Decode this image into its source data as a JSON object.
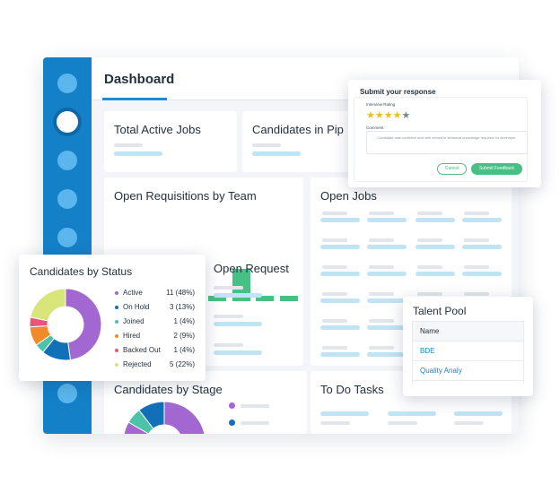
{
  "header": {
    "title": "Dashboard"
  },
  "cards": {
    "total_active_jobs": "Total Active Jobs",
    "candidates_pipeline": "Candidates in Pip",
    "open_requisitions": "Open Requisitions by Team",
    "open_jobs": "Open Jobs",
    "open_request": "Open Request",
    "candidates_by_stage": "Candidates by Stage",
    "to_do_tasks": "To Do Tasks"
  },
  "requisitions_bars": [
    0.66,
    0.27,
    0.14,
    0.74,
    0.14,
    0.9,
    0.14,
    0.14
  ],
  "response_popup": {
    "title": "Submit your response",
    "rating_label": "Interview Rating",
    "rating": 4,
    "rating_max": 5,
    "comment_label": "Comment",
    "comment_text": "Candidate was confident and well versed in technical knowledge required for developer.",
    "cancel_label": "Cancel",
    "submit_label": "Submit Feedback"
  },
  "status_card": {
    "title": "Candidates by Status",
    "items": [
      {
        "label": "Active",
        "value": "11 (48%)",
        "count": 11,
        "color": "#a367d1"
      },
      {
        "label": "On Hold",
        "value": "3 (13%)",
        "count": 3,
        "color": "#1170b8"
      },
      {
        "label": "Joined",
        "value": "1 (4%)",
        "count": 1,
        "color": "#4cc3a8"
      },
      {
        "label": "Hired",
        "value": "2 (9%)",
        "count": 2,
        "color": "#f08a2b"
      },
      {
        "label": "Backed Out",
        "value": "1 (4%)",
        "count": 1,
        "color": "#e8547a"
      },
      {
        "label": "Rejected",
        "value": "5 (22%)",
        "count": 5,
        "color": "#d7e57a"
      }
    ]
  },
  "stage_card": {
    "segments": [
      {
        "value": 40,
        "color": "#a367d1"
      },
      {
        "value": 3,
        "color": "#4cc3a8"
      },
      {
        "value": 5,
        "color": "#1170b8"
      }
    ],
    "legend_colors": [
      "#a367d1",
      "#1170b8"
    ]
  },
  "talent_pool": {
    "title": "Talent Pool",
    "header": "Name",
    "rows": [
      "BDE",
      "Quality Analy"
    ]
  },
  "colors": {
    "sidebar": "#1480c8",
    "accent_green": "#47c083",
    "accent_blue": "#1e8bd3",
    "star": "#f0b928"
  }
}
